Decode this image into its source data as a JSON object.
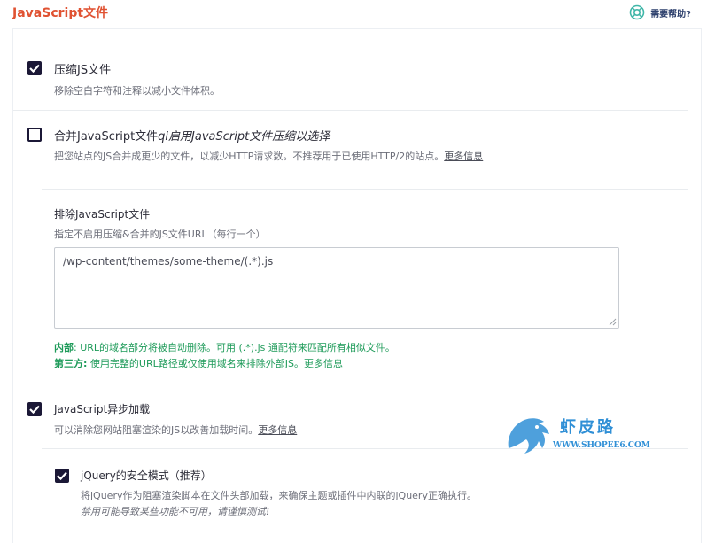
{
  "header": {
    "title": "JavaScript文件",
    "help_label": "需要帮助?"
  },
  "minify": {
    "label": "压缩JS文件",
    "description": "移除空白字符和注释以减小文件体积。",
    "checked": true
  },
  "combine": {
    "label_prefix": "合并JavaScript文件",
    "label_italic": "qi启用JavaScript文件压缩以选择",
    "description": "把您站点的JS合并成更少的文件，以减少HTTP请求数。不推荐用于已使用HTTP/2的站点。",
    "more_link": "更多信息",
    "checked": false
  },
  "exclude": {
    "title": "排除JavaScript文件",
    "description": "指定不启用压缩&合并的JS文件URL（每行一个）",
    "textarea_value": "/wp-content/themes/some-theme/(.*).js",
    "note_internal_label": "内部",
    "note_internal_text": ": URL的域名部分将被自动删除。可用 (.*).js 通配符来匹配所有相似文件。",
    "note_third_label": "第三方:",
    "note_third_text": " 使用完整的URL路径或仅使用域名来排除外部JS。",
    "note_more_link": "更多信息"
  },
  "defer": {
    "label": "JavaScript异步加载",
    "description": "可以消除您网站阻塞渲染的JS以改善加载时间。",
    "more_link": "更多信息",
    "checked": true
  },
  "jquery": {
    "label": "jQuery的安全模式（推荐）",
    "description": "将jQuery作为阻塞渲染脚本在文件头部加载，来确保主题或插件中内联的jQuery正确执行。",
    "warning": "禁用可能导致某些功能不可用，请谨慎测试!",
    "checked": true
  },
  "watermark": {
    "text_cn": "虾皮路",
    "text_url": "WWW.SHOPEE6.COM"
  },
  "colors": {
    "title": "#e05232",
    "checkbox": "#1b1836",
    "note_green": "#1f9b5a",
    "watermark_blue": "#2f8fd6"
  }
}
